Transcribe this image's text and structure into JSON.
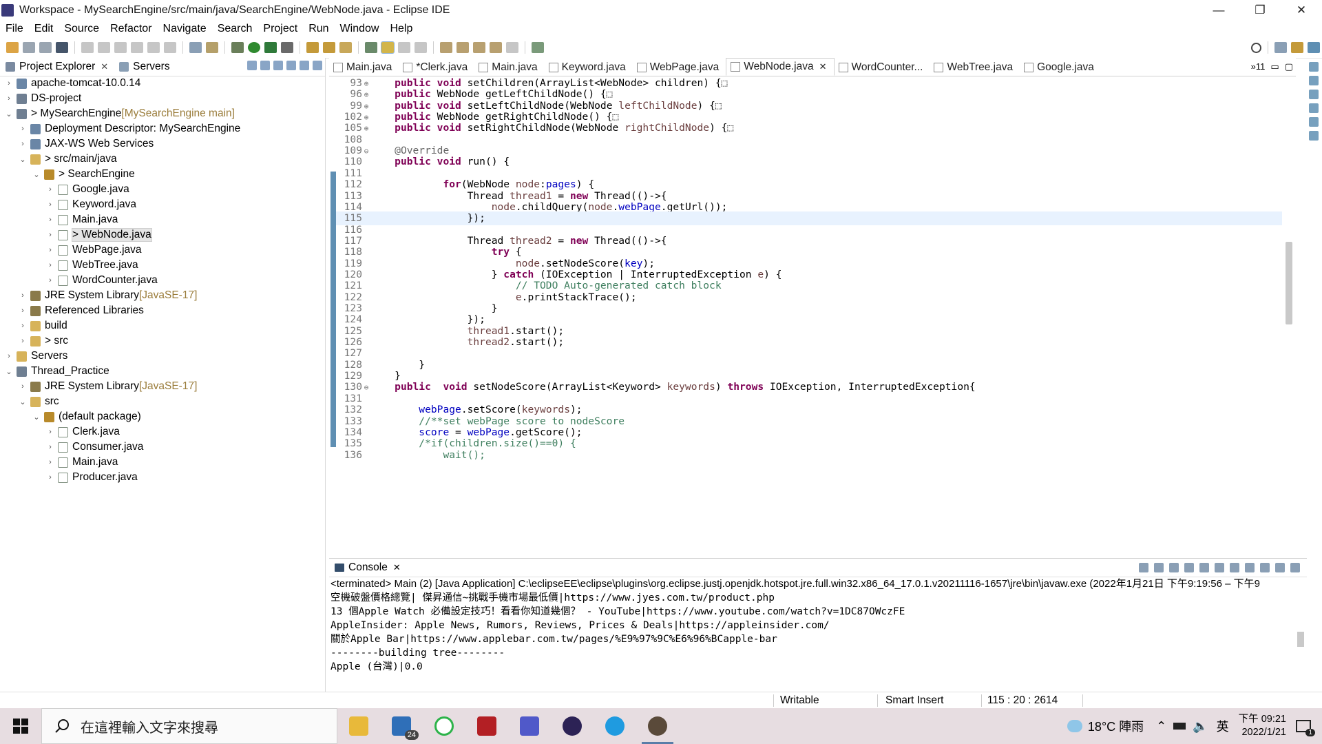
{
  "window": {
    "title": "Workspace - MySearchEngine/src/main/java/SearchEngine/WebNode.java - Eclipse IDE",
    "controls": {
      "minimize": "—",
      "restore": "❐",
      "close": "✕"
    }
  },
  "menu": [
    "File",
    "Edit",
    "Source",
    "Refactor",
    "Navigate",
    "Search",
    "Project",
    "Run",
    "Window",
    "Help"
  ],
  "left_pane": {
    "tabs": [
      {
        "label": "Project Explorer",
        "close": "✕"
      },
      {
        "label": "Servers"
      }
    ],
    "tree": [
      {
        "arrow": "›",
        "indent": 0,
        "icon": "ws",
        "label": "apache-tomcat-10.0.14"
      },
      {
        "arrow": "›",
        "indent": 0,
        "icon": "proj",
        "label": "DS-project"
      },
      {
        "arrow": "⌄",
        "indent": 0,
        "icon": "proj",
        "label": "> MySearchEngine",
        "dec": " [MySearchEngine main]"
      },
      {
        "arrow": "›",
        "indent": 1,
        "icon": "ws",
        "label": "Deployment Descriptor: MySearchEngine"
      },
      {
        "arrow": "›",
        "indent": 1,
        "icon": "ws",
        "label": "JAX-WS Web Services"
      },
      {
        "arrow": "⌄",
        "indent": 1,
        "icon": "folder",
        "label": "> src/main/java"
      },
      {
        "arrow": "⌄",
        "indent": 2,
        "icon": "pkg",
        "label": "> SearchEngine"
      },
      {
        "arrow": "›",
        "indent": 3,
        "icon": "java",
        "label": "Google.java"
      },
      {
        "arrow": "›",
        "indent": 3,
        "icon": "java",
        "label": "Keyword.java"
      },
      {
        "arrow": "›",
        "indent": 3,
        "icon": "java",
        "label": "Main.java"
      },
      {
        "arrow": "›",
        "indent": 3,
        "icon": "java",
        "label": "> WebNode.java",
        "selected": true
      },
      {
        "arrow": "›",
        "indent": 3,
        "icon": "java",
        "label": "WebPage.java"
      },
      {
        "arrow": "›",
        "indent": 3,
        "icon": "java",
        "label": "WebTree.java"
      },
      {
        "arrow": "›",
        "indent": 3,
        "icon": "java",
        "label": "WordCounter.java"
      },
      {
        "arrow": "›",
        "indent": 1,
        "icon": "lib",
        "label": "JRE System Library",
        "dec": " [JavaSE-17]"
      },
      {
        "arrow": "›",
        "indent": 1,
        "icon": "lib",
        "label": "Referenced Libraries"
      },
      {
        "arrow": "›",
        "indent": 1,
        "icon": "folder",
        "label": "build"
      },
      {
        "arrow": "›",
        "indent": 1,
        "icon": "folder",
        "label": "> src"
      },
      {
        "arrow": "›",
        "indent": 0,
        "icon": "folder",
        "label": "Servers"
      },
      {
        "arrow": "⌄",
        "indent": 0,
        "icon": "proj",
        "label": "Thread_Practice"
      },
      {
        "arrow": "›",
        "indent": 1,
        "icon": "lib",
        "label": "JRE System Library",
        "dec": " [JavaSE-17]"
      },
      {
        "arrow": "⌄",
        "indent": 1,
        "icon": "folder",
        "label": "src"
      },
      {
        "arrow": "⌄",
        "indent": 2,
        "icon": "pkg",
        "label": "(default package)"
      },
      {
        "arrow": "›",
        "indent": 3,
        "icon": "java",
        "label": "Clerk.java"
      },
      {
        "arrow": "›",
        "indent": 3,
        "icon": "java",
        "label": "Consumer.java"
      },
      {
        "arrow": "›",
        "indent": 3,
        "icon": "java",
        "label": "Main.java"
      },
      {
        "arrow": "›",
        "indent": 3,
        "icon": "java",
        "label": "Producer.java"
      }
    ]
  },
  "editor": {
    "tabs": [
      {
        "label": "Main.java"
      },
      {
        "label": "*Clerk.java"
      },
      {
        "label": "Main.java"
      },
      {
        "label": "Keyword.java"
      },
      {
        "label": "WebPage.java"
      },
      {
        "label": "WebNode.java",
        "active": true,
        "close": "✕"
      },
      {
        "label": "WordCounter..."
      },
      {
        "label": "WebTree.java"
      },
      {
        "label": "Google.java"
      }
    ],
    "overflow": "»11",
    "current_line": 115,
    "lines": [
      {
        "n": "93",
        "fold": "⊕",
        "segs": [
          [
            "",
            "    "
          ],
          [
            "kw",
            "public"
          ],
          [
            "",
            " "
          ],
          [
            "kw",
            "void"
          ],
          [
            "",
            " setChildren(ArrayList<WebNode> children) {⬚"
          ]
        ]
      },
      {
        "n": "96",
        "fold": "⊕",
        "segs": [
          [
            "",
            "    "
          ],
          [
            "kw",
            "public"
          ],
          [
            "",
            " WebNode getLeftChildNode() {⬚"
          ]
        ]
      },
      {
        "n": "99",
        "fold": "⊕",
        "segs": [
          [
            "",
            "    "
          ],
          [
            "kw",
            "public"
          ],
          [
            "",
            " "
          ],
          [
            "kw",
            "void"
          ],
          [
            "",
            " setLeftChildNode(WebNode "
          ],
          [
            "var",
            "leftChildNode"
          ],
          [
            "",
            ") {⬚"
          ]
        ]
      },
      {
        "n": "102",
        "fold": "⊕",
        "segs": [
          [
            "",
            "    "
          ],
          [
            "kw",
            "public"
          ],
          [
            "",
            " WebNode getRightChildNode() {⬚"
          ]
        ]
      },
      {
        "n": "105",
        "fold": "⊕",
        "segs": [
          [
            "",
            "    "
          ],
          [
            "kw",
            "public"
          ],
          [
            "",
            " "
          ],
          [
            "kw",
            "void"
          ],
          [
            "",
            " setRightChildNode(WebNode "
          ],
          [
            "var",
            "rightChildNode"
          ],
          [
            "",
            ") {⬚"
          ]
        ]
      },
      {
        "n": "108",
        "fold": "",
        "segs": []
      },
      {
        "n": "109",
        "fold": "⊖",
        "segs": [
          [
            "",
            "    "
          ],
          [
            "an",
            "@Override"
          ]
        ]
      },
      {
        "n": "110",
        "fold": "",
        "segs": [
          [
            "",
            "    "
          ],
          [
            "kw",
            "public"
          ],
          [
            "",
            " "
          ],
          [
            "kw",
            "void"
          ],
          [
            "",
            " run() {"
          ]
        ]
      },
      {
        "n": "111",
        "fold": "",
        "segs": []
      },
      {
        "n": "112",
        "fold": "",
        "segs": [
          [
            "",
            "            "
          ],
          [
            "kw",
            "for"
          ],
          [
            "",
            "(WebNode "
          ],
          [
            "var",
            "node"
          ],
          [
            "",
            ":"
          ],
          [
            "fld",
            "pages"
          ],
          [
            "",
            ") {"
          ]
        ]
      },
      {
        "n": "113",
        "fold": "",
        "segs": [
          [
            "",
            "                Thread "
          ],
          [
            "var",
            "thread1"
          ],
          [
            "",
            " = "
          ],
          [
            "kw",
            "new"
          ],
          [
            "",
            " Thread(()->{"
          ]
        ]
      },
      {
        "n": "114",
        "fold": "",
        "segs": [
          [
            "",
            "                    "
          ],
          [
            "var",
            "node"
          ],
          [
            "",
            ".childQuery("
          ],
          [
            "var",
            "node"
          ],
          [
            "",
            "."
          ],
          [
            "fld",
            "webPage"
          ],
          [
            "",
            ".getUrl());"
          ]
        ]
      },
      {
        "n": "115",
        "fold": "",
        "segs": [
          [
            "",
            "                });"
          ]
        ]
      },
      {
        "n": "116",
        "fold": "",
        "segs": []
      },
      {
        "n": "117",
        "fold": "",
        "segs": [
          [
            "",
            "                Thread "
          ],
          [
            "var",
            "thread2"
          ],
          [
            "",
            " = "
          ],
          [
            "kw",
            "new"
          ],
          [
            "",
            " Thread(()->{"
          ]
        ]
      },
      {
        "n": "118",
        "fold": "",
        "segs": [
          [
            "",
            "                    "
          ],
          [
            "kw",
            "try"
          ],
          [
            "",
            " {"
          ]
        ]
      },
      {
        "n": "119",
        "fold": "",
        "segs": [
          [
            "",
            "                        "
          ],
          [
            "var",
            "node"
          ],
          [
            "",
            ".setNodeScore("
          ],
          [
            "fld",
            "key"
          ],
          [
            "",
            ");"
          ]
        ]
      },
      {
        "n": "120",
        "fold": "",
        "segs": [
          [
            "",
            "                    } "
          ],
          [
            "kw",
            "catch"
          ],
          [
            "",
            " (IOException | InterruptedException "
          ],
          [
            "var",
            "e"
          ],
          [
            "",
            ") {"
          ]
        ]
      },
      {
        "n": "121",
        "fold": "",
        "segs": [
          [
            "",
            "                        "
          ],
          [
            "cm",
            "// TODO Auto-generated catch block"
          ]
        ]
      },
      {
        "n": "122",
        "fold": "",
        "segs": [
          [
            "",
            "                        "
          ],
          [
            "var",
            "e"
          ],
          [
            "",
            ".printStackTrace();"
          ]
        ]
      },
      {
        "n": "123",
        "fold": "",
        "segs": [
          [
            "",
            "                    }"
          ]
        ]
      },
      {
        "n": "124",
        "fold": "",
        "segs": [
          [
            "",
            "                });"
          ]
        ]
      },
      {
        "n": "125",
        "fold": "",
        "segs": [
          [
            "",
            "                "
          ],
          [
            "var",
            "thread1"
          ],
          [
            "",
            ".start();"
          ]
        ]
      },
      {
        "n": "126",
        "fold": "",
        "segs": [
          [
            "",
            "                "
          ],
          [
            "var",
            "thread2"
          ],
          [
            "",
            ".start();"
          ]
        ]
      },
      {
        "n": "127",
        "fold": "",
        "segs": []
      },
      {
        "n": "128",
        "fold": "",
        "segs": [
          [
            "",
            "        }"
          ]
        ]
      },
      {
        "n": "129",
        "fold": "",
        "segs": [
          [
            "",
            "    }"
          ]
        ]
      },
      {
        "n": "130",
        "fold": "⊖",
        "segs": [
          [
            "",
            "    "
          ],
          [
            "kw",
            "public"
          ],
          [
            "",
            "  "
          ],
          [
            "kw",
            "void"
          ],
          [
            "",
            " setNodeScore(ArrayList<Keyword> "
          ],
          [
            "var",
            "keywords"
          ],
          [
            "",
            ") "
          ],
          [
            "kw",
            "throws"
          ],
          [
            "",
            " IOException, InterruptedException{"
          ]
        ]
      },
      {
        "n": "131",
        "fold": "",
        "segs": []
      },
      {
        "n": "132",
        "fold": "",
        "segs": [
          [
            "",
            "        "
          ],
          [
            "fld",
            "webPage"
          ],
          [
            "",
            ".setScore("
          ],
          [
            "var",
            "keywords"
          ],
          [
            "",
            ");"
          ]
        ]
      },
      {
        "n": "133",
        "fold": "",
        "segs": [
          [
            "",
            "        "
          ],
          [
            "cm",
            "//**set webPage score to nodeScore"
          ]
        ]
      },
      {
        "n": "134",
        "fold": "",
        "segs": [
          [
            "",
            "        "
          ],
          [
            "fld",
            "score"
          ],
          [
            "",
            " = "
          ],
          [
            "fld",
            "webPage"
          ],
          [
            "",
            ".getScore();"
          ]
        ]
      },
      {
        "n": "135",
        "fold": "",
        "segs": [
          [
            "",
            "        "
          ],
          [
            "cm",
            "/*if(children.size()==0) {"
          ]
        ]
      },
      {
        "n": "136",
        "fold": "",
        "segs": [
          [
            "",
            "            "
          ],
          [
            "cm",
            "wait();"
          ]
        ]
      }
    ]
  },
  "console": {
    "tab": "Console",
    "close": "✕",
    "status": "<terminated> Main (2) [Java Application] C:\\eclipseEE\\eclipse\\plugins\\org.eclipse.justj.openjdk.hotspot.jre.full.win32.x86_64_17.0.1.v20211116-1657\\jre\\bin\\javaw.exe  (2022年1月21日 下午9:19:56 – 下午9",
    "lines": [
      "空機破盤價格總覽| 傑昇通信~挑戰手機市場最低價|https://www.jyes.com.tw/product.php",
      "13 個Apple Watch 必備設定技巧！看看你知道幾個？ - YouTube|https://www.youtube.com/watch?v=1DC87OWczFE",
      "AppleInsider: Apple News, Rumors, Reviews, Prices & Deals|https://appleinsider.com/",
      "關於Apple Bar|https://www.applebar.com.tw/pages/%E9%97%9C%E6%96%BCapple-bar",
      "--------building tree--------",
      "Apple (台灣)|0.0"
    ]
  },
  "statusbar": {
    "writable": "Writable",
    "insert_mode": "Smart Insert",
    "position": "115 : 20 : 2614"
  },
  "taskbar": {
    "search_placeholder": "在這裡輸入文字來搜尋",
    "mail_badge": "24",
    "weather": "18°C  陣雨",
    "ime": "英",
    "time": "下午 09:21",
    "date": "2022/1/21",
    "notifications": "1"
  },
  "colors": {
    "keyword": "#7f0055",
    "comment": "#3f7f5f",
    "field": "#0000c0",
    "local_var": "#6a3e3e",
    "current_line": "#e8f2fe",
    "taskbar_bg": "#e7dde1"
  }
}
